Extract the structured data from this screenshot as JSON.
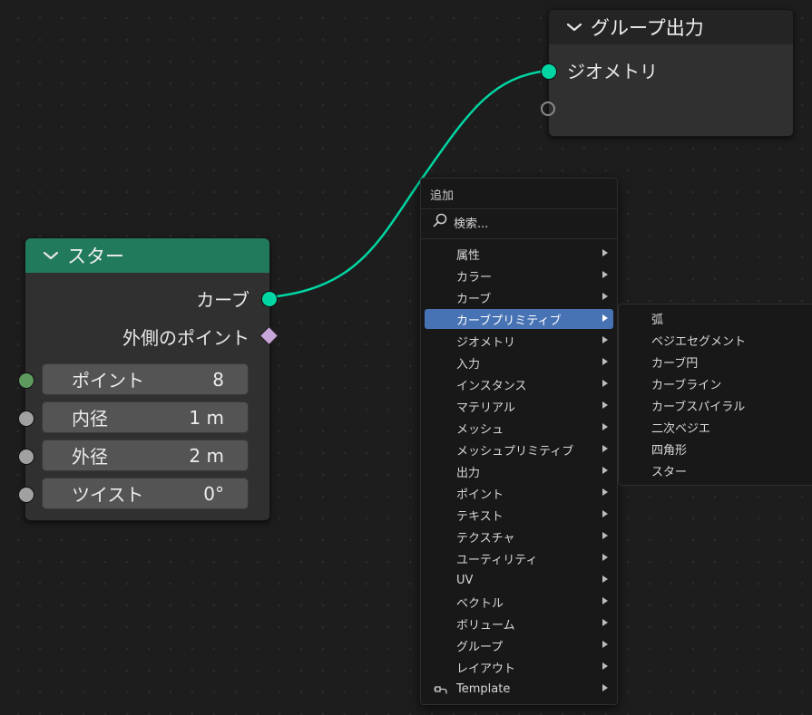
{
  "star_node": {
    "title": "スター",
    "header_color": "#217a5c",
    "outputs": [
      {
        "label": "カーブ",
        "socket_color": "#00d6a3"
      },
      {
        "label": "外側のポイント",
        "socket_color": "#c9a6d9"
      }
    ],
    "inputs": [
      {
        "label": "ポイント",
        "value": "8",
        "socket_color": "#5e9a5e"
      },
      {
        "label": "内径",
        "value": "1 m",
        "socket_color": "#a1a1a1"
      },
      {
        "label": "外径",
        "value": "2 m",
        "socket_color": "#a1a1a1"
      },
      {
        "label": "ツイスト",
        "value": "0°",
        "socket_color": "#a1a1a1"
      }
    ]
  },
  "group_output_node": {
    "title": "グループ出力",
    "header_color": "#242424",
    "inputs": [
      {
        "label": "ジオメトリ",
        "socket_color": "#00d6a3"
      }
    ]
  },
  "link_color": "#00d6a3",
  "add_menu": {
    "title": "追加",
    "search_label": "検索...",
    "items": [
      "属性",
      "カラー",
      "カーブ",
      "カーブプリミティブ",
      "ジオメトリ",
      "入力",
      "インスタンス",
      "マテリアル",
      "メッシュ",
      "メッシュプリミティブ",
      "出力",
      "ポイント",
      "テキスト",
      "テクスチャ",
      "ユーティリティ",
      "UV",
      "ベクトル",
      "ボリューム",
      "グループ",
      "レイアウト",
      "Template"
    ],
    "active_item": "カーブプリミティブ",
    "highlight_color": "#4772b3"
  },
  "curve_primitive_submenu": {
    "items": [
      "弧",
      "ベジエセグメント",
      "カーブ円",
      "カーブライン",
      "カーブスパイラル",
      "二次ベジエ",
      "四角形",
      "スター"
    ]
  }
}
